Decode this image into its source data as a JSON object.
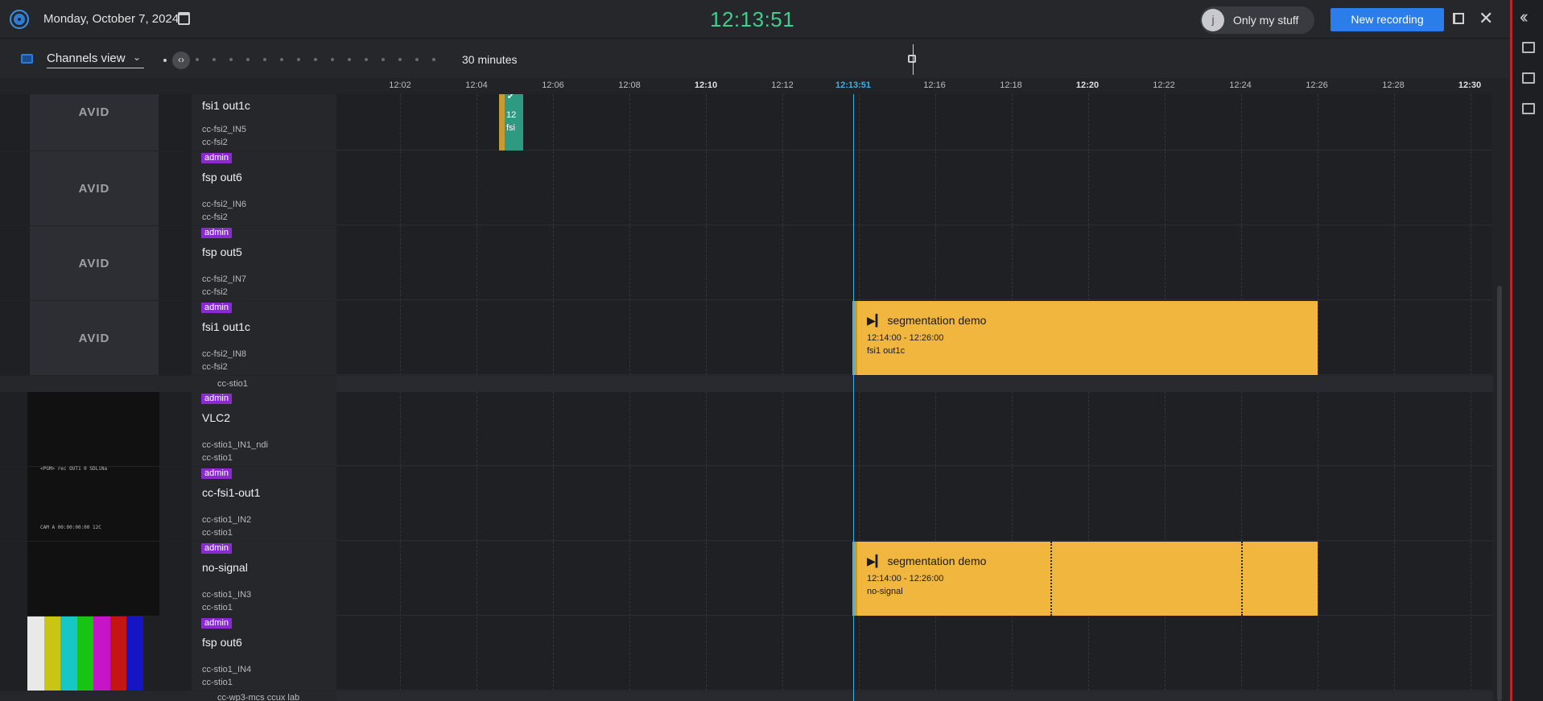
{
  "header": {
    "date": "Monday, October 7, 2024",
    "clock": "12:13:51",
    "avatar_initial": "j",
    "only_my_stuff": "Only my stuff",
    "new_recording": "New recording"
  },
  "toolbar": {
    "view": "Channels view",
    "zoom_label": "30 minutes"
  },
  "axis": {
    "ticks": [
      "12:02",
      "12:04",
      "12:06",
      "12:08",
      "12:10",
      "12:12",
      "12:13:51",
      "12:16",
      "12:18",
      "12:20",
      "12:22",
      "12:24",
      "12:26",
      "12:28",
      "12:30"
    ]
  },
  "channels": [
    {
      "name": "fsi1 out1c",
      "input": "cc-fsi2_IN5",
      "server": "cc-fsi2",
      "badge": "admin"
    },
    {
      "name": "fsp out6",
      "input": "cc-fsi2_IN6",
      "server": "cc-fsi2",
      "badge": "admin"
    },
    {
      "name": "fsp out5",
      "input": "cc-fsi2_IN7",
      "server": "cc-fsi2",
      "badge": "admin"
    },
    {
      "name": "fsi1 out1c",
      "input": "cc-fsi2_IN8",
      "server": "cc-fsi2",
      "badge": "admin"
    },
    {
      "name": "VLC2",
      "input": "cc-stio1_IN1_ndi",
      "server": "cc-stio1",
      "badge": "admin"
    },
    {
      "name": "cc-fsi1-out1",
      "input": "cc-stio1_IN2",
      "server": "cc-stio1",
      "badge": "admin"
    },
    {
      "name": "no-signal",
      "input": "cc-stio1_IN3",
      "server": "cc-stio1",
      "badge": "admin"
    },
    {
      "name": "fsp out6",
      "input": "cc-stio1_IN4",
      "server": "cc-stio1",
      "badge": "admin"
    }
  ],
  "groups": [
    "cc-stio1",
    "cc-wp3-mcs ccux lab"
  ],
  "thumb_logo": "AVID",
  "events": [
    {
      "title": "segmentation demo",
      "time": "12:14:00 - 12:26:00",
      "channel": "fsi1 out1c"
    },
    {
      "title": "segmentation demo",
      "time": "12:14:00 - 12:26:00",
      "channel": "no-signal"
    }
  ],
  "mini_event": {
    "time": "12",
    "channel": "fsi"
  },
  "thumb_texts": {
    "vlc_line1": "<PGM>  rec  OUT1        0      SDLiNa",
    "vlc_line2": "CAM A       00:00:00:00          12C"
  }
}
